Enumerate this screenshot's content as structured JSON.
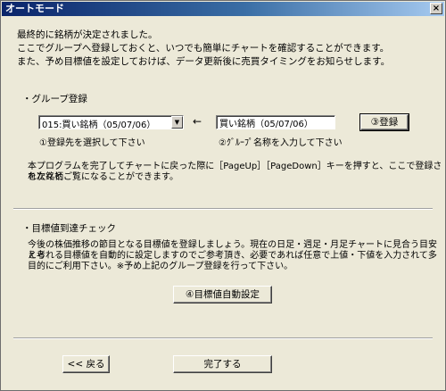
{
  "window": {
    "title": "オートモード",
    "close_glyph": "×"
  },
  "intro": {
    "line1": "最終的に銘柄が決定されました。",
    "line2": "ここでグループへ登録しておくと、いつでも簡単にチャートを確認することができます。",
    "line3": "また、予め目標値を設定しておけば、データ更新後に売買タイミングをお知らせします。"
  },
  "group": {
    "section_title": "・グループ登録",
    "select_value": "015:買い銘柄（05/07/06）",
    "arrow": "←",
    "name_value": "買い銘柄（05/07/06）",
    "register_button": "③登録",
    "hint_select": "①登録先を選択して下さい",
    "hint_name": "②ｸﾞﾙｰﾌﾟ名称を入力して下さい",
    "note_line1": "本プログラムを完了してチャートに戻った際に［PageUp］［PageDown］キーを押すと、ここで登録された銘柄",
    "note_line2": "を次々とご覧になることができます。"
  },
  "target": {
    "section_title": "・目標値到達チェック",
    "desc_line1": "今後の株価推移の節目となる目標値を登録しましょう。現在の日足・週足・月足チャートに見合う目安と考",
    "desc_line2": "えられる目標値を自動的に設定しますのでご参考頂き、必要であれば任意で上値・下値を入力されて多",
    "desc_line3": "目的にご利用下さい。※予め上記のグループ登録を行って下さい。",
    "auto_button": "④目標値自動設定"
  },
  "footer": {
    "back_button": "<< 戻る",
    "finish_button": "完了する"
  }
}
